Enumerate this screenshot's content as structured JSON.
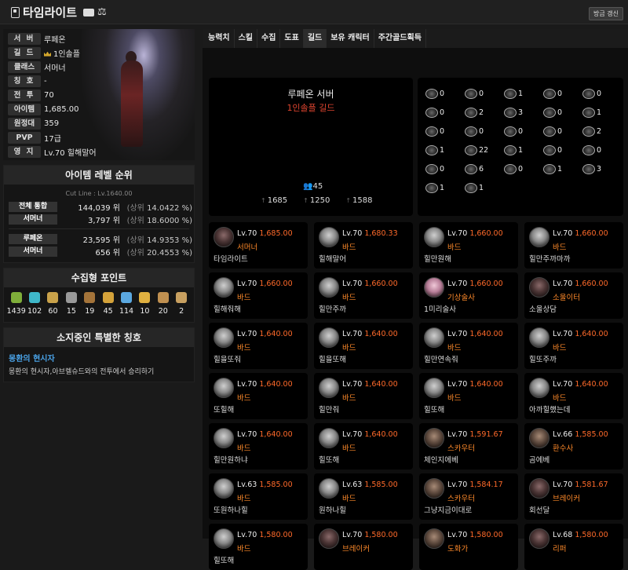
{
  "header": {
    "title": "타임라이트",
    "refresh_label": "방금 갱신"
  },
  "profile": {
    "rows": [
      {
        "label": "서 버",
        "value": "루페온"
      },
      {
        "label": "길 드",
        "value": "1인솔플",
        "crown": true
      },
      {
        "label": "클래스",
        "value": "서머너"
      },
      {
        "label": "칭 호",
        "value": "-"
      },
      {
        "label": "전 투",
        "value": "70"
      },
      {
        "label": "아이템",
        "value": "1,685.00"
      },
      {
        "label": "원정대",
        "value": "359"
      },
      {
        "label": "PVP",
        "value": "17급"
      },
      {
        "label": "영 지",
        "value": "Lv.70 힐해말어"
      }
    ]
  },
  "item_rank": {
    "title": "아이템 레벨 순위",
    "cutline": "Cut Line : Lv.1640.00",
    "top": [
      {
        "label": "전체 통합",
        "rank": "144,039 위",
        "pct_prefix": "(상위",
        "pct": "14.0422 %)"
      },
      {
        "label": "서머너",
        "rank": "3,797 위",
        "pct_prefix": "(상위",
        "pct": "18.6000 %)"
      }
    ],
    "bottom": [
      {
        "label": "루페온",
        "rank": "23,595 위",
        "pct_prefix": "(상위",
        "pct": "14.9353 %)"
      },
      {
        "label": "서머너",
        "rank": "656 위",
        "pct_prefix": "(상위",
        "pct": "20.4553 %)"
      }
    ]
  },
  "collection": {
    "title": "수집형 포인트",
    "items": [
      {
        "icon": "seed-icon",
        "value": "1439",
        "color": "#7fae3a"
      },
      {
        "icon": "island-icon",
        "value": "102",
        "color": "#3fb7c9"
      },
      {
        "icon": "card-icon",
        "value": "60",
        "color": "#c9a24a"
      },
      {
        "icon": "heart-icon",
        "value": "15",
        "color": "#999999"
      },
      {
        "icon": "art-icon",
        "value": "19",
        "color": "#a4743a"
      },
      {
        "icon": "voyage-icon",
        "value": "45",
        "color": "#d4a23a"
      },
      {
        "icon": "star-icon",
        "value": "114",
        "color": "#5ba8e0"
      },
      {
        "icon": "tree-icon",
        "value": "10",
        "color": "#e0b040"
      },
      {
        "icon": "medal-icon",
        "value": "20",
        "color": "#c09050"
      },
      {
        "icon": "map-icon",
        "value": "2",
        "color": "#c8a060"
      }
    ]
  },
  "special_title": {
    "title": "소지중인 특별한 칭호",
    "name": "몽환의 현시자",
    "desc": "몽환의 현시자,아브렐슈드와의 전투에서 승리하기"
  },
  "tabs": [
    "능력치",
    "스킬",
    "수집",
    "도표",
    "길드",
    "보유 캐릭터",
    "주간골드획득"
  ],
  "guild": {
    "server": "루페온 서버",
    "name": "1인솔플 길드",
    "count": "45",
    "stats": [
      "1685",
      "1250",
      "1588"
    ]
  },
  "class_counts": [
    "0",
    "0",
    "1",
    "0",
    "0",
    "0",
    "2",
    "3",
    "0",
    "1",
    "0",
    "0",
    "0",
    "0",
    "2",
    "1",
    "22",
    "1",
    "0",
    "0",
    "0",
    "6",
    "0",
    "1",
    "3",
    "1",
    "1"
  ],
  "members": [
    {
      "lv": "Lv.70",
      "il": "1,685.00",
      "cls": "서머너",
      "name": "타임라이트",
      "av": "dark"
    },
    {
      "lv": "Lv.70",
      "il": "1,680.33",
      "cls": "바드",
      "name": "힐해말어",
      "av": "silver"
    },
    {
      "lv": "Lv.70",
      "il": "1,660.00",
      "cls": "바드",
      "name": "힐만원해",
      "av": "silver"
    },
    {
      "lv": "Lv.70",
      "il": "1,660.00",
      "cls": "바드",
      "name": "힐만주까마까",
      "av": "silver"
    },
    {
      "lv": "Lv.70",
      "il": "1,660.00",
      "cls": "바드",
      "name": "힐해줘해",
      "av": "silver"
    },
    {
      "lv": "Lv.70",
      "il": "1,660.00",
      "cls": "바드",
      "name": "힐만주까",
      "av": "silver"
    },
    {
      "lv": "Lv.70",
      "il": "1,660.00",
      "cls": "기상술사",
      "name": "1미리술사",
      "av": "pink"
    },
    {
      "lv": "Lv.70",
      "il": "1,660.00",
      "cls": "소울이터",
      "name": "소울상담",
      "av": "dark"
    },
    {
      "lv": "Lv.70",
      "il": "1,640.00",
      "cls": "바드",
      "name": "힐을또줘",
      "av": "silver"
    },
    {
      "lv": "Lv.70",
      "il": "1,640.00",
      "cls": "바드",
      "name": "힐을또해",
      "av": "silver"
    },
    {
      "lv": "Lv.70",
      "il": "1,640.00",
      "cls": "바드",
      "name": "힐만연속줘",
      "av": "silver"
    },
    {
      "lv": "Lv.70",
      "il": "1,640.00",
      "cls": "바드",
      "name": "힐또주까",
      "av": "silver"
    },
    {
      "lv": "Lv.70",
      "il": "1,640.00",
      "cls": "바드",
      "name": "또힐해",
      "av": "silver"
    },
    {
      "lv": "Lv.70",
      "il": "1,640.00",
      "cls": "바드",
      "name": "힐만줘",
      "av": "silver"
    },
    {
      "lv": "Lv.70",
      "il": "1,640.00",
      "cls": "바드",
      "name": "힐또해",
      "av": "silver"
    },
    {
      "lv": "Lv.70",
      "il": "1,640.00",
      "cls": "바드",
      "name": "아까힐했는데",
      "av": "silver"
    },
    {
      "lv": "Lv.70",
      "il": "1,640.00",
      "cls": "바드",
      "name": "힐만원하냐",
      "av": "silver"
    },
    {
      "lv": "Lv.70",
      "il": "1,640.00",
      "cls": "바드",
      "name": "힐또해",
      "av": "silver"
    },
    {
      "lv": "Lv.70",
      "il": "1,591.67",
      "cls": "스카우터",
      "name": "체인지에베",
      "av": "brown"
    },
    {
      "lv": "Lv.66",
      "il": "1,585.00",
      "cls": "환수사",
      "name": "곰에베",
      "av": "brown"
    },
    {
      "lv": "Lv.63",
      "il": "1,585.00",
      "cls": "바드",
      "name": "또원하나힐",
      "av": "silver"
    },
    {
      "lv": "Lv.63",
      "il": "1,585.00",
      "cls": "바드",
      "name": "원하나힐",
      "av": "silver"
    },
    {
      "lv": "Lv.70",
      "il": "1,584.17",
      "cls": "스카우터",
      "name": "그냥지금이대로",
      "av": "brown"
    },
    {
      "lv": "Lv.70",
      "il": "1,581.67",
      "cls": "브레이커",
      "name": "회선달",
      "av": "dark"
    },
    {
      "lv": "Lv.70",
      "il": "1,580.00",
      "cls": "바드",
      "name": "힐또해",
      "av": "silver"
    },
    {
      "lv": "Lv.70",
      "il": "1,580.00",
      "cls": "브레이커",
      "name": "",
      "av": "dark"
    },
    {
      "lv": "Lv.70",
      "il": "1,580.00",
      "cls": "도화가",
      "name": "",
      "av": "brown"
    },
    {
      "lv": "Lv.68",
      "il": "1,580.00",
      "cls": "리퍼",
      "name": "",
      "av": "dark"
    }
  ]
}
